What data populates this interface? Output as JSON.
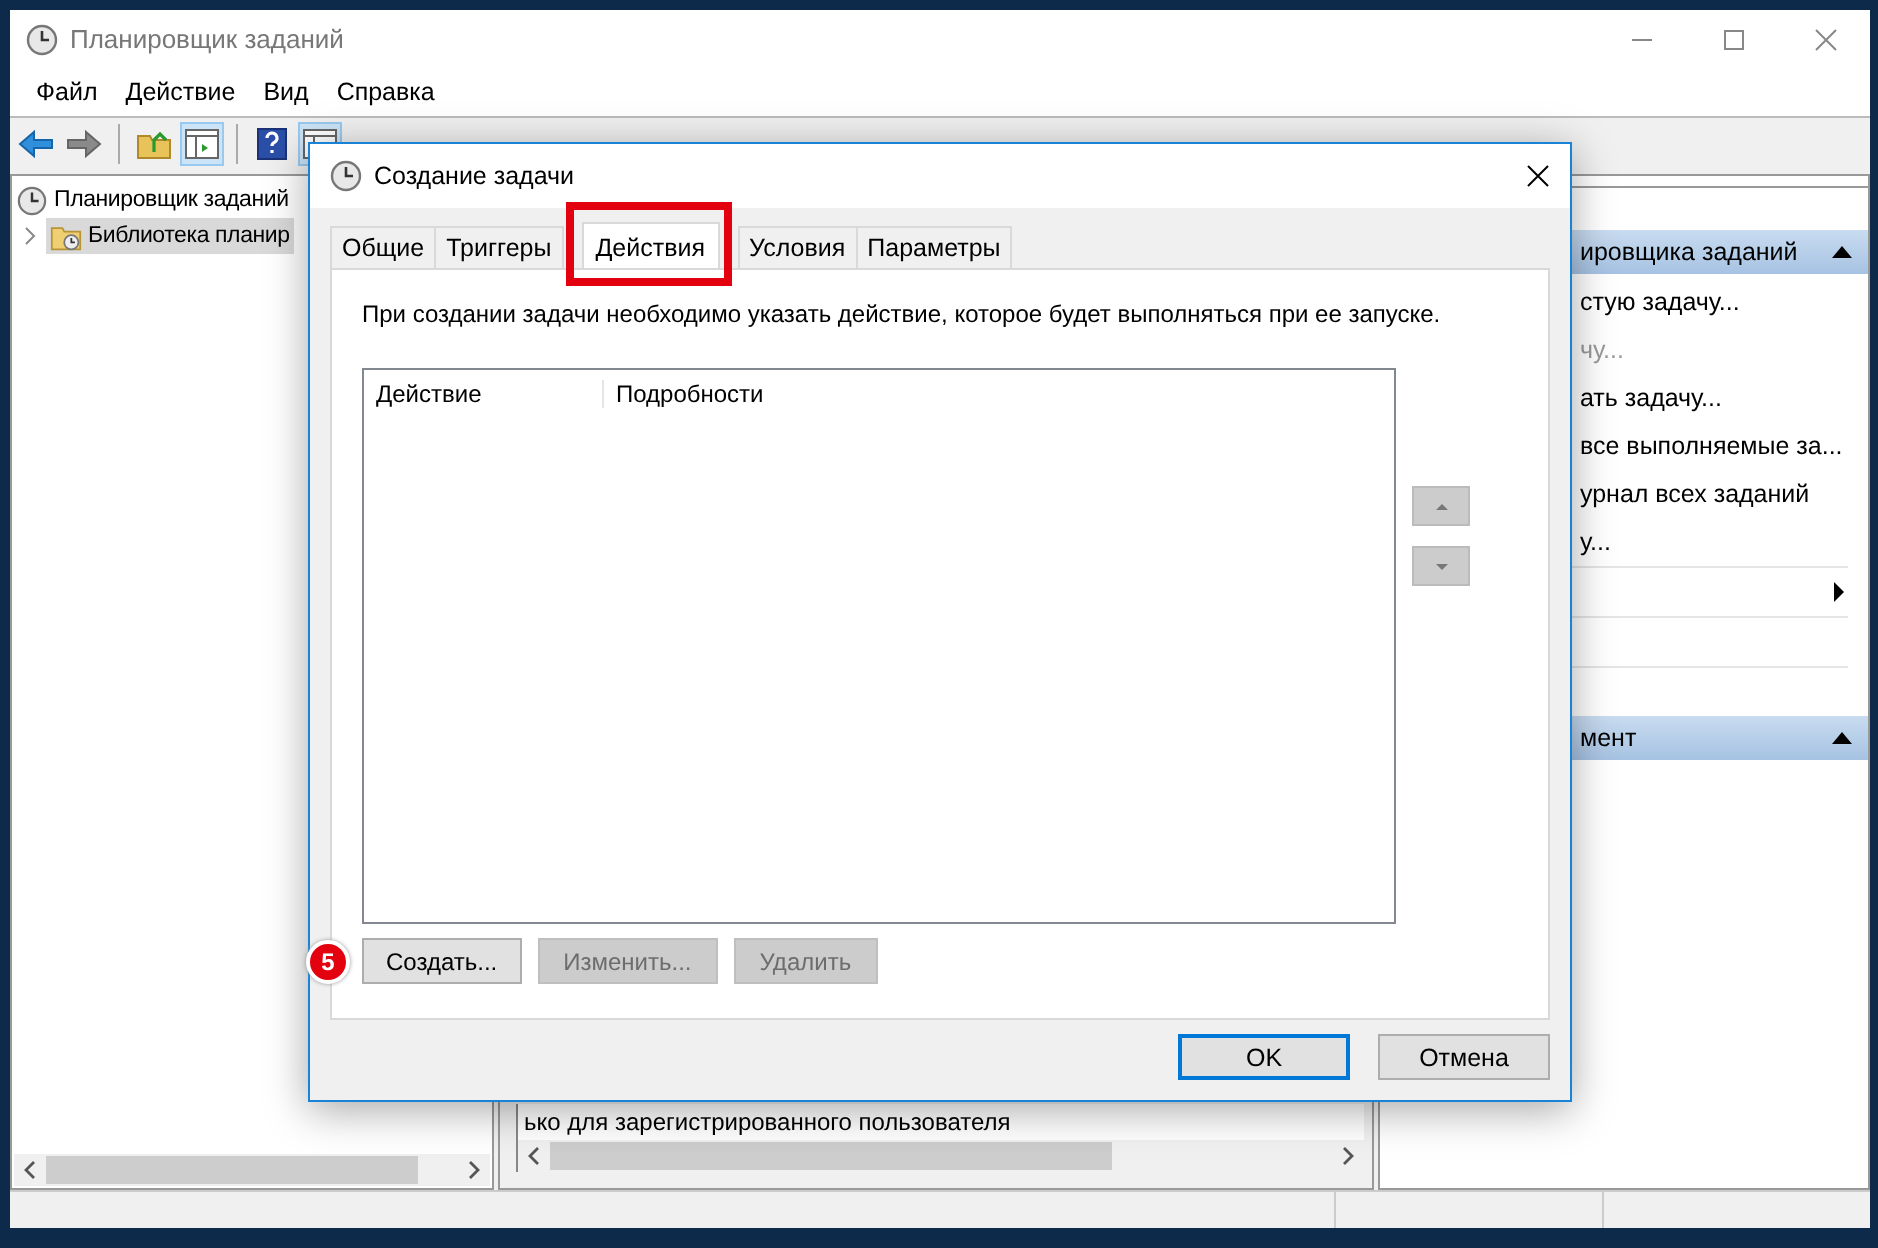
{
  "window": {
    "title": "Планировщик заданий"
  },
  "menu": [
    "Файл",
    "Действие",
    "Вид",
    "Справка"
  ],
  "toolbar": [
    {
      "kind": "back",
      "pressed": false
    },
    {
      "kind": "forward",
      "pressed": false
    },
    {
      "kind": "separator"
    },
    {
      "kind": "folder-up",
      "pressed": false
    },
    {
      "kind": "panel",
      "pressed": true
    },
    {
      "kind": "separator"
    },
    {
      "kind": "help",
      "pressed": false
    },
    {
      "kind": "panel-play",
      "pressed": true
    }
  ],
  "tree": [
    {
      "label": "Планировщик заданий",
      "selected": false,
      "kind": "clock",
      "children": [
        {
          "label": "Библиотека планир",
          "selected": true,
          "expanded": false,
          "kind": "folder"
        }
      ]
    }
  ],
  "middle": {
    "rows": [
      "ько для зарегистрированного пользователя"
    ]
  },
  "actions_pane": {
    "sections": [
      {
        "title": "ировщика заданий",
        "expanded": true,
        "items": [
          {
            "kind": "text",
            "label": "стую задачу...",
            "disabled": false
          },
          {
            "kind": "text",
            "label": "чу...",
            "disabled": true
          },
          {
            "kind": "text",
            "label": "ать задачу...",
            "disabled": false
          },
          {
            "kind": "text",
            "label": "все выполняемые за...",
            "disabled": false
          },
          {
            "kind": "text",
            "label": "урнал всех заданий",
            "disabled": false
          },
          {
            "kind": "text",
            "label": "у...",
            "disabled": false
          },
          {
            "kind": "submenu"
          },
          {
            "kind": "blank"
          },
          {
            "kind": "blank"
          }
        ]
      },
      {
        "title": "мент",
        "expanded": true
      }
    ]
  },
  "dialog": {
    "title": "Создание задачи",
    "tabs": [
      {
        "label": "Общие",
        "selected": false,
        "highlighted": false
      },
      {
        "label": "Триггеры",
        "selected": false,
        "highlighted": false
      },
      {
        "label": "Действия",
        "selected": true,
        "highlighted": true
      },
      {
        "label": "Условия",
        "selected": false,
        "highlighted": false
      },
      {
        "label": "Параметры",
        "selected": false,
        "highlighted": false
      }
    ],
    "description": "При создании задачи необходимо указать действие, которое будет выполняться при ее запуске.",
    "table": {
      "columns": [
        "Действие",
        "Подробности"
      ]
    },
    "step_badge": "5",
    "buttons": [
      {
        "label": "Создать...",
        "disabled": false
      },
      {
        "label": "Изменить...",
        "disabled": true
      },
      {
        "label": "Удалить",
        "disabled": true
      }
    ],
    "footer_buttons": [
      {
        "label": "OK",
        "default": true
      },
      {
        "label": "Отмена",
        "default": false
      }
    ]
  }
}
